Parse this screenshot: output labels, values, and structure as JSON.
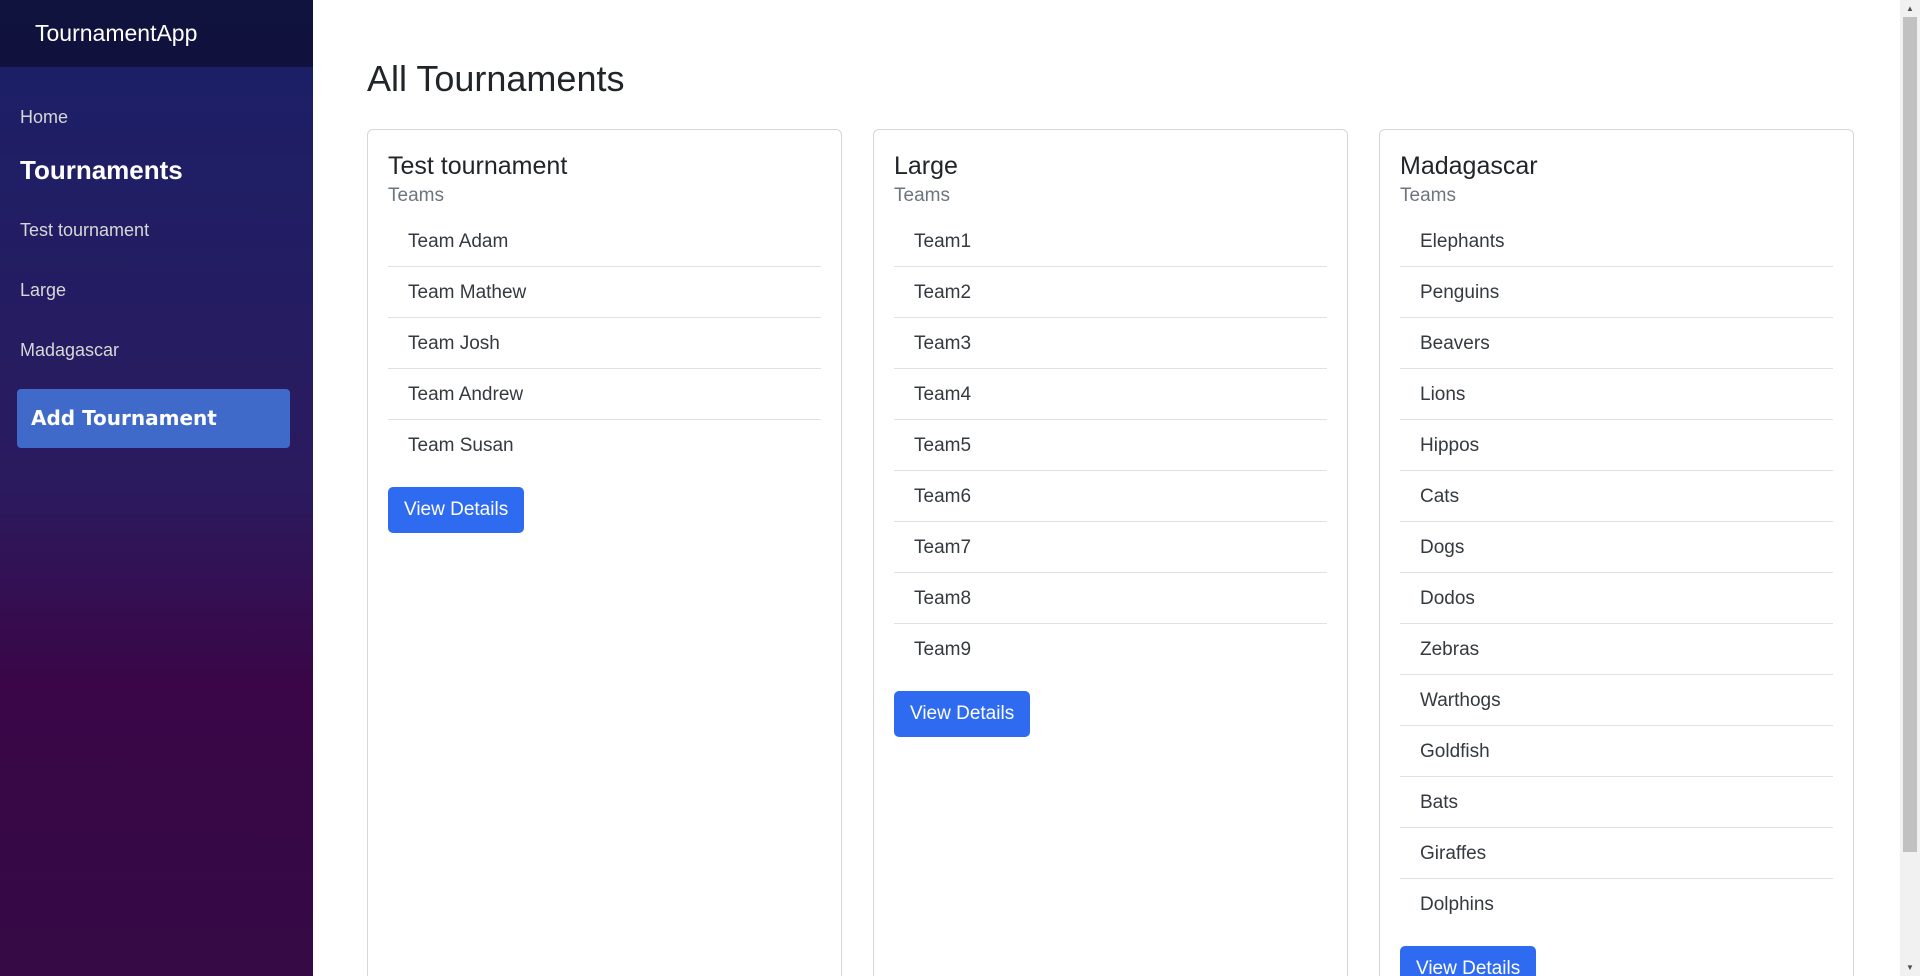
{
  "sidebar": {
    "brand": "TournamentApp",
    "home_label": "Home",
    "section_heading": "Tournaments",
    "tournament_links": [
      "Test tournament",
      "Large",
      "Madagascar"
    ],
    "add_button_label": "Add Tournament"
  },
  "main": {
    "page_title": "All Tournaments",
    "cards": [
      {
        "title": "Test tournament",
        "subtitle": "Teams",
        "teams": [
          "Team Adam",
          "Team Mathew",
          "Team Josh",
          "Team Andrew",
          "Team Susan"
        ],
        "button_label": "View Details"
      },
      {
        "title": "Large",
        "subtitle": "Teams",
        "teams": [
          "Team1",
          "Team2",
          "Team3",
          "Team4",
          "Team5",
          "Team6",
          "Team7",
          "Team8",
          "Team9"
        ],
        "button_label": "View Details"
      },
      {
        "title": "Madagascar",
        "subtitle": "Teams",
        "teams": [
          "Elephants",
          "Penguins",
          "Beavers",
          "Lions",
          "Hippos",
          "Cats",
          "Dogs",
          "Dodos",
          "Zebras",
          "Warthogs",
          "Goldfish",
          "Bats",
          "Giraffes",
          "Dolphins"
        ],
        "button_label": "View Details"
      }
    ]
  },
  "colors": {
    "primary_button": "#2f6bf0",
    "sidebar_top": "#1a2068",
    "sidebar_bottom": "#350a45",
    "add_button": "#4378dc"
  },
  "icons": {
    "scroll_up": "scroll-up-arrow-icon",
    "scroll_down": "scroll-down-arrow-icon"
  }
}
